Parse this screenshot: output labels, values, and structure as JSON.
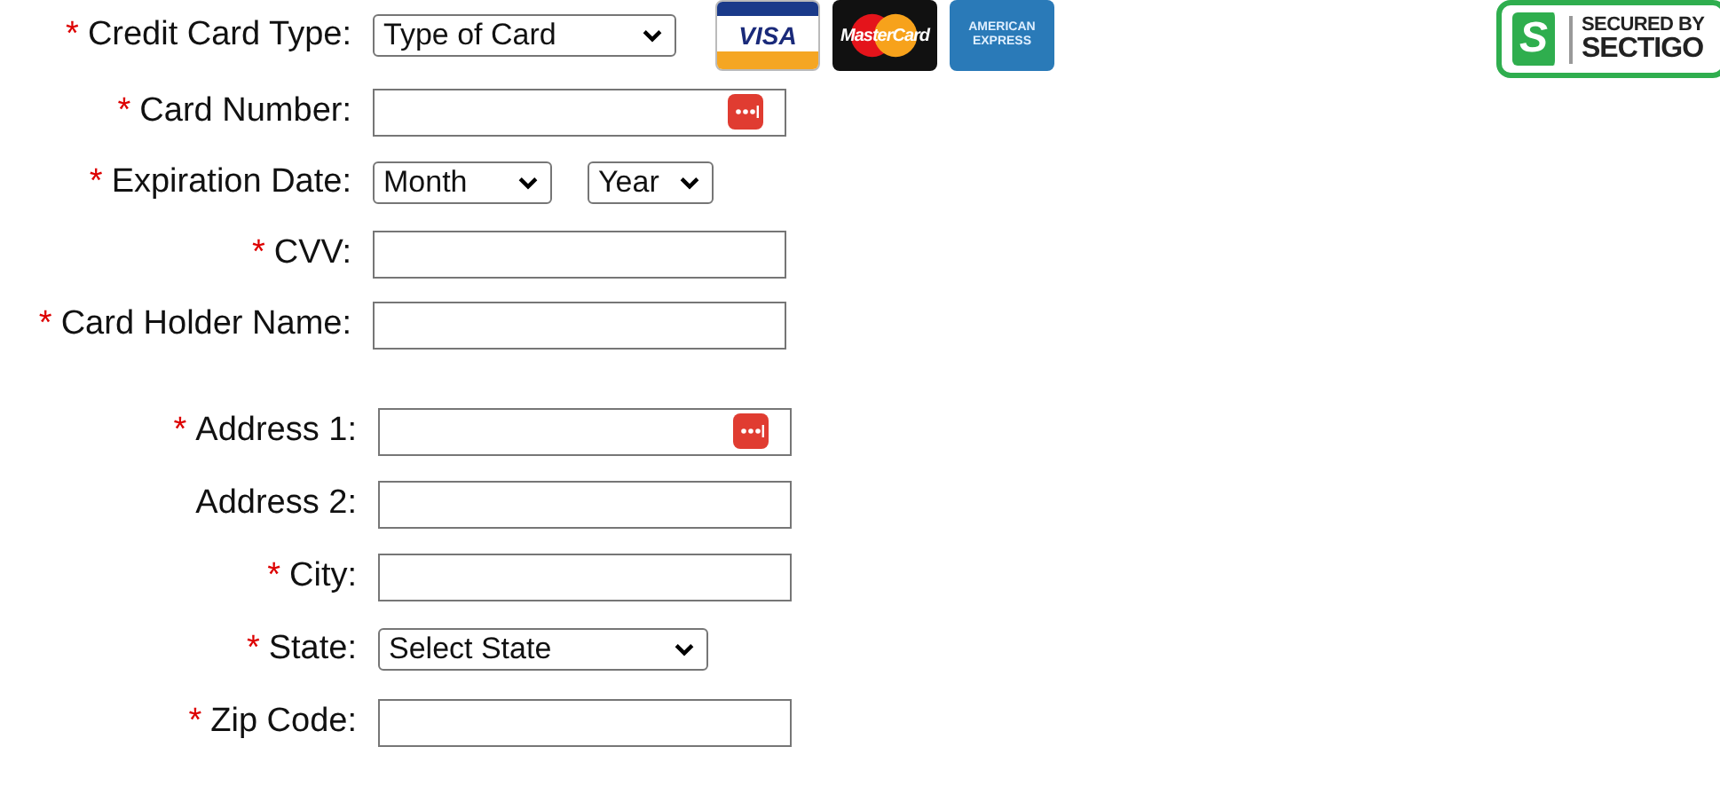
{
  "groups": [
    {
      "fields": [
        {
          "kind": "select",
          "mark": "*",
          "label": "Credit Card Type:",
          "value": "Type of Card",
          "logos": [
            {
              "kind": "visa",
              "text": "VISA"
            },
            {
              "kind": "mastercard",
              "text": "MasterCard"
            },
            {
              "kind": "amex",
              "text": "AMERICAN EXPRESS"
            }
          ]
        },
        {
          "kind": "text",
          "mark": "*",
          "label": "Card Number:",
          "password_manager": true
        },
        {
          "kind": "date",
          "mark": "*",
          "label": "Expiration Date:",
          "values": [
            "Month",
            "Year"
          ]
        },
        {
          "kind": "text",
          "mark": "*",
          "label": "CVV:"
        },
        {
          "kind": "text",
          "mark": "*",
          "label": "Card Holder Name:"
        }
      ]
    },
    {
      "fields": [
        {
          "kind": "text",
          "mark": "*",
          "label": "Address 1:",
          "password_manager": true
        },
        {
          "kind": "text",
          "label": "Address 2:"
        },
        {
          "kind": "text",
          "mark": "*",
          "label": "City:"
        },
        {
          "kind": "select",
          "mark": "*",
          "label": "State:",
          "value": "Select State"
        },
        {
          "kind": "text",
          "mark": "*",
          "label": "Zip Code:"
        }
      ]
    }
  ],
  "badge": {
    "logo": "S",
    "line_1": "SECURED BY",
    "line_2": "SECTIGO"
  }
}
